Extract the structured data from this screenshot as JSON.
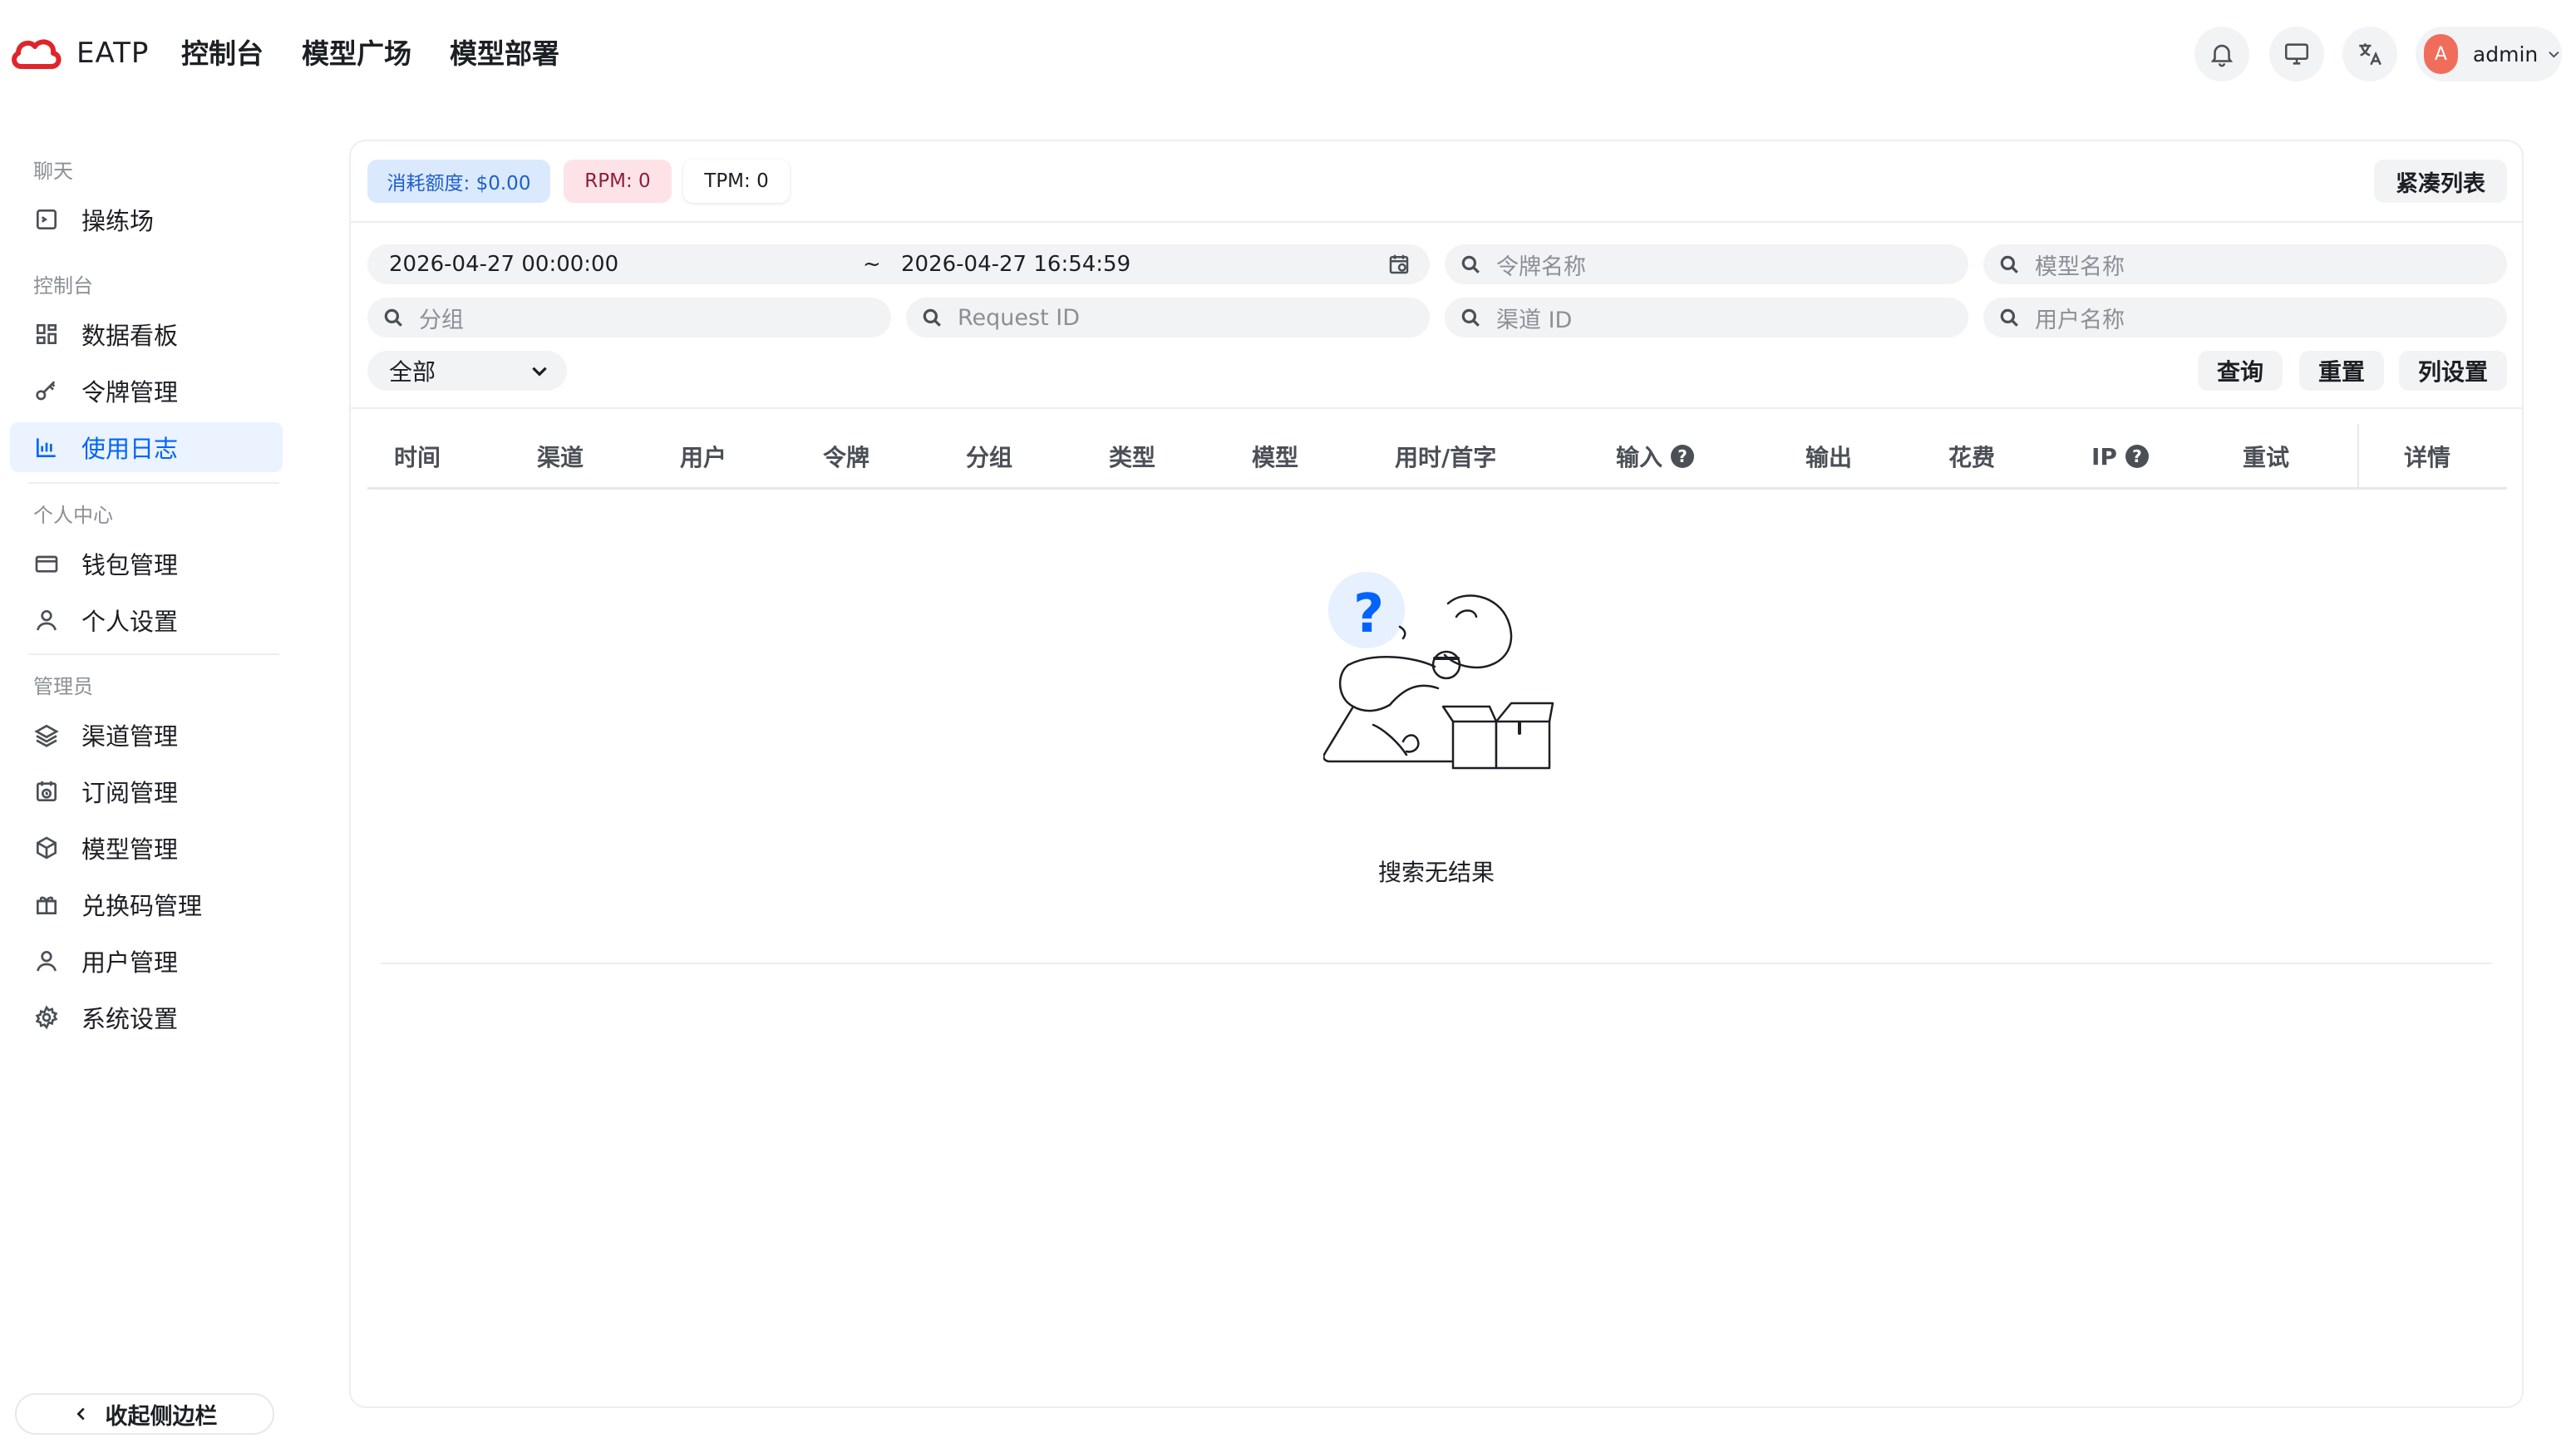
{
  "header": {
    "brand": "EATP",
    "nav": [
      "控制台",
      "模型广场",
      "模型部署"
    ],
    "user": {
      "avatar_letter": "A",
      "name": "admin"
    },
    "colors": {
      "brand_red": "#e0252a",
      "accent": "#0064fa"
    }
  },
  "sidebar": {
    "sections": [
      {
        "title": "聊天",
        "items": [
          {
            "label": "操练场",
            "icon": "playground-icon"
          }
        ]
      },
      {
        "title": "控制台",
        "items": [
          {
            "label": "数据看板",
            "icon": "dashboard-icon"
          },
          {
            "label": "令牌管理",
            "icon": "key-icon"
          },
          {
            "label": "使用日志",
            "icon": "chart-icon",
            "active": true
          }
        ]
      },
      {
        "title": "个人中心",
        "items": [
          {
            "label": "钱包管理",
            "icon": "wallet-icon"
          },
          {
            "label": "个人设置",
            "icon": "user-icon"
          }
        ]
      },
      {
        "title": "管理员",
        "items": [
          {
            "label": "渠道管理",
            "icon": "layers-icon"
          },
          {
            "label": "订阅管理",
            "icon": "calendar-clock-icon"
          },
          {
            "label": "模型管理",
            "icon": "cube-icon"
          },
          {
            "label": "兑换码管理",
            "icon": "gift-icon"
          },
          {
            "label": "用户管理",
            "icon": "user-icon"
          },
          {
            "label": "系统设置",
            "icon": "gear-icon"
          }
        ]
      }
    ],
    "collapse_label": "收起侧边栏"
  },
  "stats": {
    "quota": "消耗额度: $0.00",
    "rpm": "RPM: 0",
    "tpm": "TPM: 0"
  },
  "compact_label": "紧凑列表",
  "filters": {
    "start_date": "2026-04-27 00:00:00",
    "separator": "~",
    "end_date": "2026-04-27 16:54:59",
    "token_name_placeholder": "令牌名称",
    "model_name_placeholder": "模型名称",
    "group_placeholder": "分组",
    "request_id_placeholder": "Request ID",
    "channel_id_placeholder": "渠道 ID",
    "username_placeholder": "用户名称",
    "type_select": "全部"
  },
  "actions": {
    "query": "查询",
    "reset": "重置",
    "columns": "列设置"
  },
  "table": {
    "columns": [
      "时间",
      "渠道",
      "用户",
      "令牌",
      "分组",
      "类型",
      "模型",
      "用时/首字",
      "输入",
      "输出",
      "花费",
      "IP",
      "重试",
      "详情"
    ],
    "rows": [],
    "empty_text": "搜索无结果"
  }
}
